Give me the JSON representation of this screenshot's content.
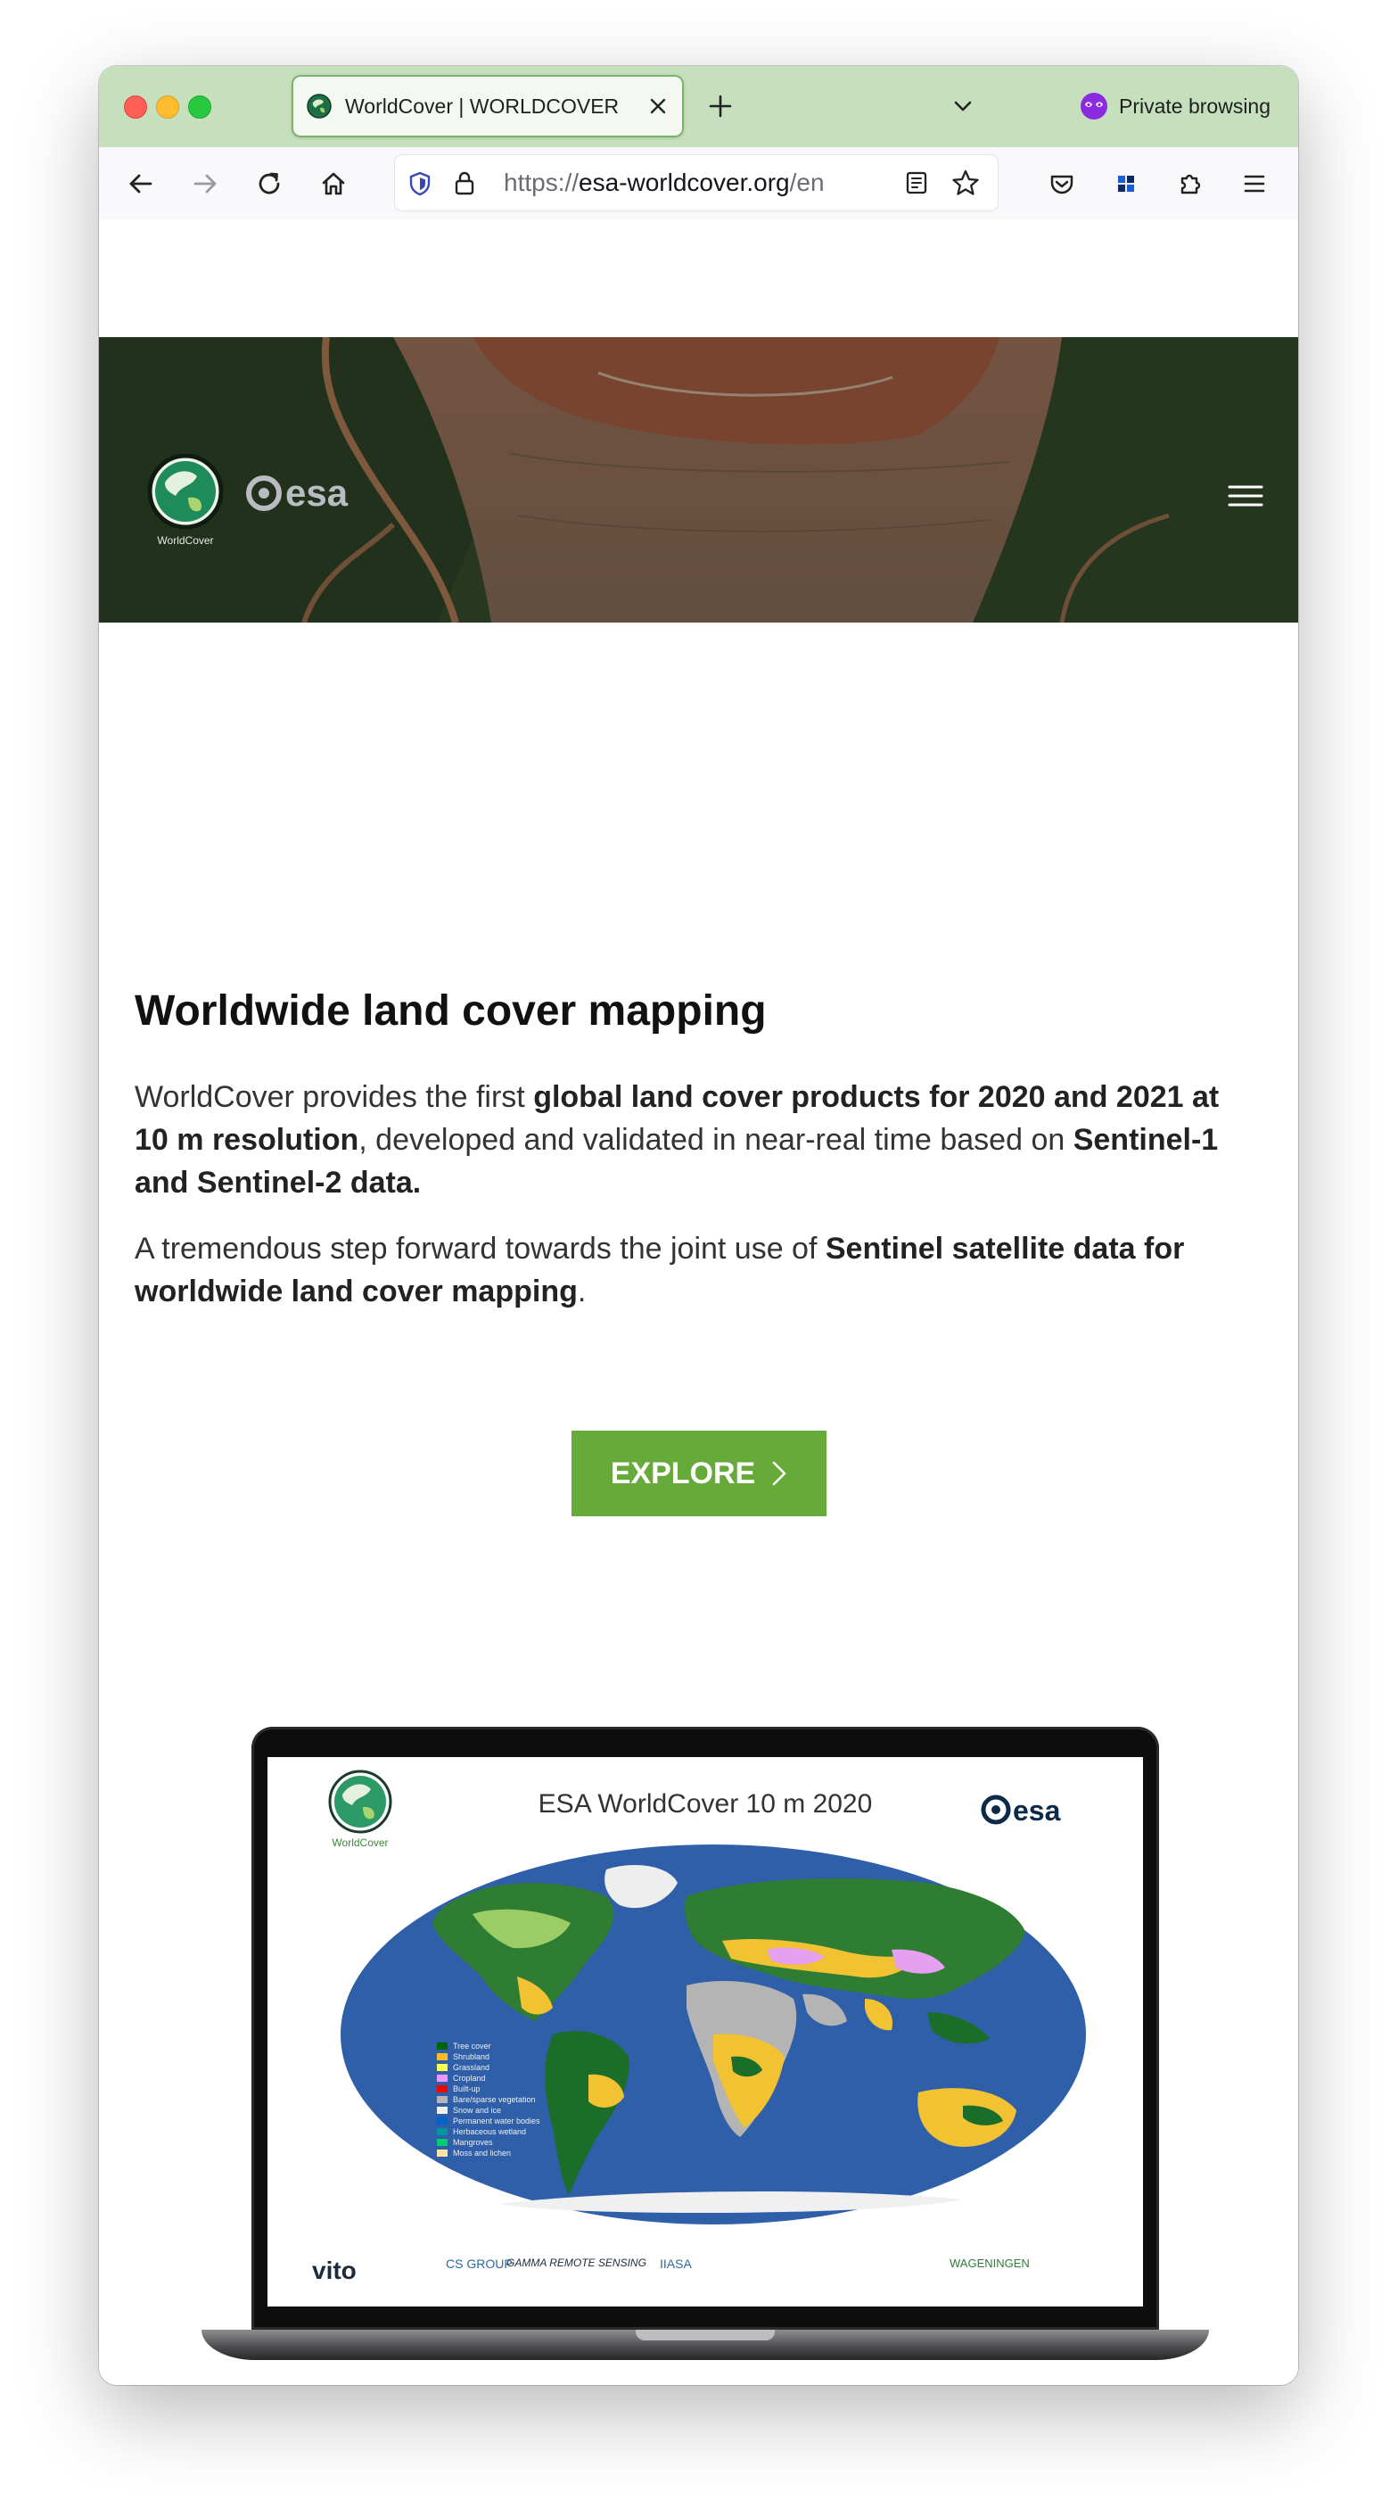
{
  "browser": {
    "tab": {
      "title": "WorldCover | WORLDCOVER"
    },
    "private_label": "Private browsing",
    "url": {
      "scheme": "https://",
      "host": "esa-worldcover.org",
      "path": "/en"
    }
  },
  "hero": {
    "logo_label": "WorldCover",
    "esa_label": "esa"
  },
  "main": {
    "headline": "Worldwide land cover mapping",
    "para1": [
      {
        "text": "WorldCover provides the first ",
        "bold": false
      },
      {
        "text": "global land cover products for 2020 and 2021 at 10 m resolution",
        "bold": true
      },
      {
        "text": ", developed and validated in near-real time based on ",
        "bold": false
      },
      {
        "text": "Sentinel-1 and Sentinel-2 data.",
        "bold": true
      }
    ],
    "para2": [
      {
        "text": "A tremendous step forward towards the joint use of ",
        "bold": false
      },
      {
        "text": "Sentinel satellite data for worldwide land cover mapping",
        "bold": true
      },
      {
        "text": ".",
        "bold": false
      }
    ],
    "explore_label": "EXPLORE"
  },
  "laptop": {
    "map_title": "ESA WorldCover 10 m 2020",
    "logo_label": "WorldCover",
    "esa_label": "esa",
    "legend": [
      {
        "label": "Tree cover",
        "color": "#006400"
      },
      {
        "label": "Shrubland",
        "color": "#ffbb22"
      },
      {
        "label": "Grassland",
        "color": "#ffff4c"
      },
      {
        "label": "Cropland",
        "color": "#f096ff"
      },
      {
        "label": "Built-up",
        "color": "#fa0000"
      },
      {
        "label": "Bare/sparse vegetation",
        "color": "#b4b4b4"
      },
      {
        "label": "Snow and ice",
        "color": "#f0f0f0"
      },
      {
        "label": "Permanent water bodies",
        "color": "#0064c8"
      },
      {
        "label": "Herbaceous wetland",
        "color": "#0096a0"
      },
      {
        "label": "Mangroves",
        "color": "#00cf75"
      },
      {
        "label": "Moss and lichen",
        "color": "#fae6a0"
      }
    ],
    "partners": [
      "vito",
      "CS GROUP",
      "GAMMA REMOTE SENSING",
      "IIASA",
      "WAGENINGEN"
    ]
  },
  "colors": {
    "tabbar": "#c6dfbd",
    "accent_green": "#66aa3a",
    "ocean": "#2f5fa8"
  }
}
